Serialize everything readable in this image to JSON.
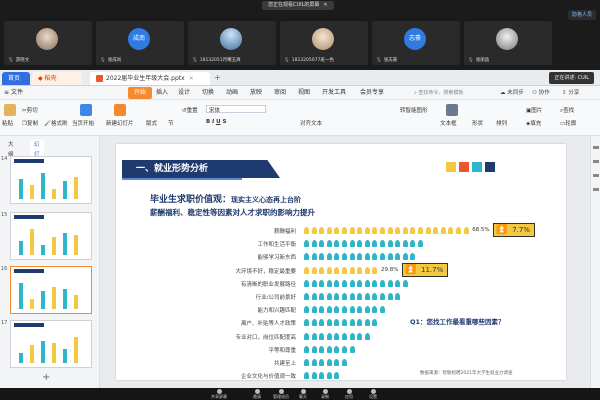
{
  "meeting": {
    "share_banner": "您正在观看CUIL的屏幕",
    "top_button": "隐格人员",
    "participants": [
      {
        "name": "游晓文",
        "avatar": "",
        "style": "photo1"
      },
      {
        "name": "张成尚",
        "avatar": "成南",
        "style": "blue"
      },
      {
        "name": "18132051月曙玉爽",
        "avatar": "",
        "style": "photo2"
      },
      {
        "name": "1813205077班一色",
        "avatar": "",
        "style": "photo3"
      },
      {
        "name": "张志豪",
        "avatar": "志豪",
        "style": "blue"
      },
      {
        "name": "张丽晶",
        "avatar": "",
        "style": "photo4"
      }
    ],
    "live_badge": "正在讲述: CUIL",
    "controls": [
      "共享屏幕",
      "邀请",
      "管理成员",
      "聊天",
      "录制",
      "应用",
      "设置"
    ]
  },
  "tabs": {
    "home": "首页",
    "shell": "稻壳",
    "doc": "2022届毕业生年级大会.pptx"
  },
  "menubar": {
    "file": "文件",
    "items": [
      "开始",
      "插入",
      "设计",
      "切换",
      "动画",
      "放映",
      "审阅",
      "视图",
      "开发工具",
      "会员专享"
    ],
    "active": "开始",
    "search": "查找命令、搜索模板",
    "right": [
      "未同步",
      "协作",
      "分享"
    ]
  },
  "ribbon": {
    "paste": "粘贴",
    "cut": "剪切",
    "copy": "复制",
    "format_painter": "格式刷",
    "from_start": "当页开始",
    "new_slide": "新建幻灯片",
    "layout": "版式",
    "section": "节",
    "reset": "重置",
    "font": "宋体",
    "textbox": "文本框",
    "shape": "形状",
    "arrange": "排列",
    "picture": "图片",
    "fill": "填充",
    "outline": "轮廓",
    "find": "查找",
    "replace": "替换",
    "align_text": "对齐文本",
    "smart_art": "转智能图形"
  },
  "leftpanel": {
    "tab_outline": "大纲",
    "tab_slides": "幻灯片",
    "thumbs": [
      "14",
      "15",
      "16",
      "17"
    ]
  },
  "slide": {
    "section_title": "一、就业形势分析",
    "heading_main": "毕业生求职价值观：",
    "heading_rest": "现实主义心态再上台阶",
    "subheading": "薪酬福利、稳定性等因素对人才求职的影响力提升",
    "question": "Q1：您找工作最看重哪些因素？",
    "source": "数据来源：智联招聘2021年大学生就业力调查",
    "accent_colors": [
      "#f5c842",
      "#e8582c",
      "#2fb5c8",
      "#1f3a6e"
    ]
  },
  "chart_data": {
    "type": "bar",
    "categories": [
      "薪酬福利",
      "工作和生活平衡",
      "能够学习新东西",
      "大环境不好，稳定最重要",
      "有清晰的职业发展路径",
      "行业/公司前景好",
      "能力和兴趣匹配",
      "离户、补贴等人才政策",
      "专业对口，岗位匹配度高",
      "平等和尊重",
      "共建至上",
      "企业文化与价值观一致"
    ],
    "values": [
      68.5,
      50,
      46,
      29.8,
      44,
      40,
      35,
      32,
      28,
      22,
      18,
      15
    ],
    "data_labels": {
      "0": "68.5%",
      "3": "29.8%"
    },
    "annotations": [
      {
        "category_index": 0,
        "text": "7.7%"
      },
      {
        "category_index": 3,
        "text": "11.7%"
      }
    ],
    "highlight_indices": [
      0,
      3
    ],
    "highlight_color": "#f5c842",
    "base_color": "#2fb5c8",
    "ylim": [
      0,
      70
    ]
  }
}
